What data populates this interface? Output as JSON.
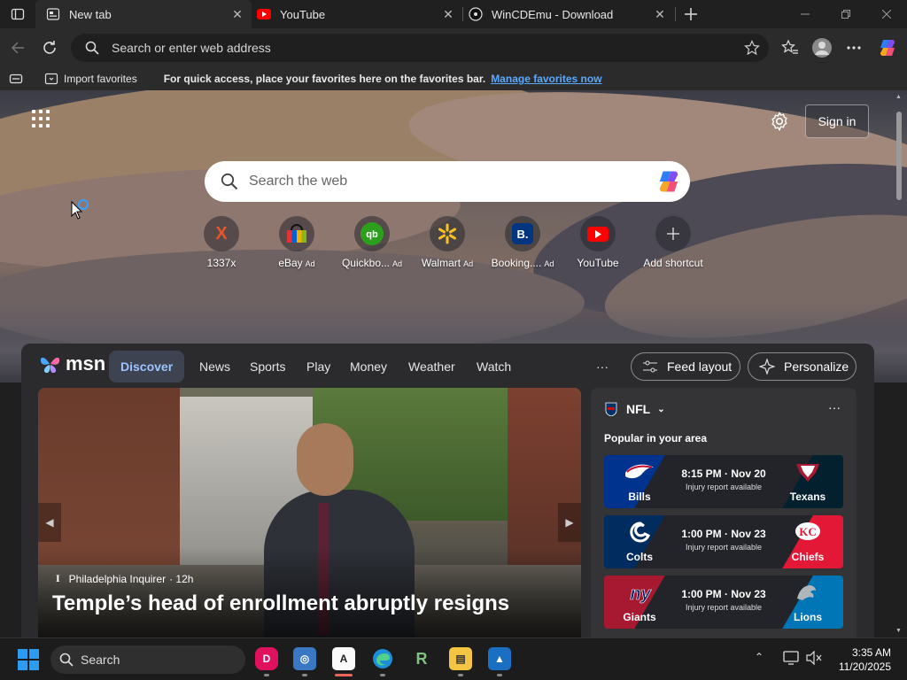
{
  "tabs": [
    {
      "label": "New tab",
      "active": true,
      "icon": "new-tab-icon"
    },
    {
      "label": "YouTube",
      "active": false,
      "icon": "youtube-icon"
    },
    {
      "label": "WinCDEmu - Download",
      "active": false,
      "icon": "wincdemu-icon"
    }
  ],
  "toolbar": {
    "address_placeholder": "Search or enter web address"
  },
  "favorites_bar": {
    "import_label": "Import favorites",
    "message": "For quick access, place your favorites here on the favorites bar.",
    "manage_link": "Manage favorites now"
  },
  "newtab": {
    "signin_label": "Sign in",
    "search_placeholder": "Search the web",
    "shortcuts": [
      {
        "label": "1337x",
        "ad": "",
        "icon": "1337x-icon"
      },
      {
        "label": "eBay",
        "ad": "Ad",
        "icon": "ebay-icon"
      },
      {
        "label": "Quickbo...",
        "ad": "Ad",
        "icon": "quickbooks-icon"
      },
      {
        "label": "Walmart",
        "ad": "Ad",
        "icon": "walmart-icon"
      },
      {
        "label": "Booking....",
        "ad": "Ad",
        "icon": "booking-icon"
      },
      {
        "label": "YouTube",
        "ad": "",
        "icon": "youtube-icon"
      },
      {
        "label": "Add shortcut",
        "ad": "",
        "icon": "plus-icon"
      }
    ]
  },
  "feed": {
    "logo": "msn",
    "nav": [
      "Discover",
      "News",
      "Sports",
      "Play",
      "Money",
      "Weather",
      "Watch"
    ],
    "more": "···",
    "feed_layout_label": "Feed layout",
    "personalize_label": "Personalize",
    "hero": {
      "source": "Philadelphia Inquirer",
      "age": "· 12h",
      "headline": "Temple’s head of enrollment abruptly resigns"
    },
    "nfl": {
      "title": "NFL",
      "more": "···",
      "subtitle": "Popular in your area",
      "games": [
        {
          "home": "Bills",
          "away": "Texans",
          "time": "8:15 PM · Nov 20",
          "note": "Injury report available",
          "home_color": "#00338d",
          "away_color": "#03202f"
        },
        {
          "home": "Colts",
          "away": "Chiefs",
          "time": "1:00 PM · Nov 23",
          "note": "Injury report available",
          "home_color": "#002c5f",
          "away_color": "#e31837"
        },
        {
          "home": "Giants",
          "away": "Lions",
          "time": "1:00 PM · Nov 23",
          "note": "Injury report available",
          "home_color": "#a71930",
          "away_color": "#0076b6"
        }
      ]
    }
  },
  "taskbar": {
    "search_label": "Search",
    "time": "3:35 AM",
    "date": "11/20/2025"
  },
  "colors": {
    "accent": "#5aa9ff",
    "discover_tab": "#9cc4ff"
  }
}
